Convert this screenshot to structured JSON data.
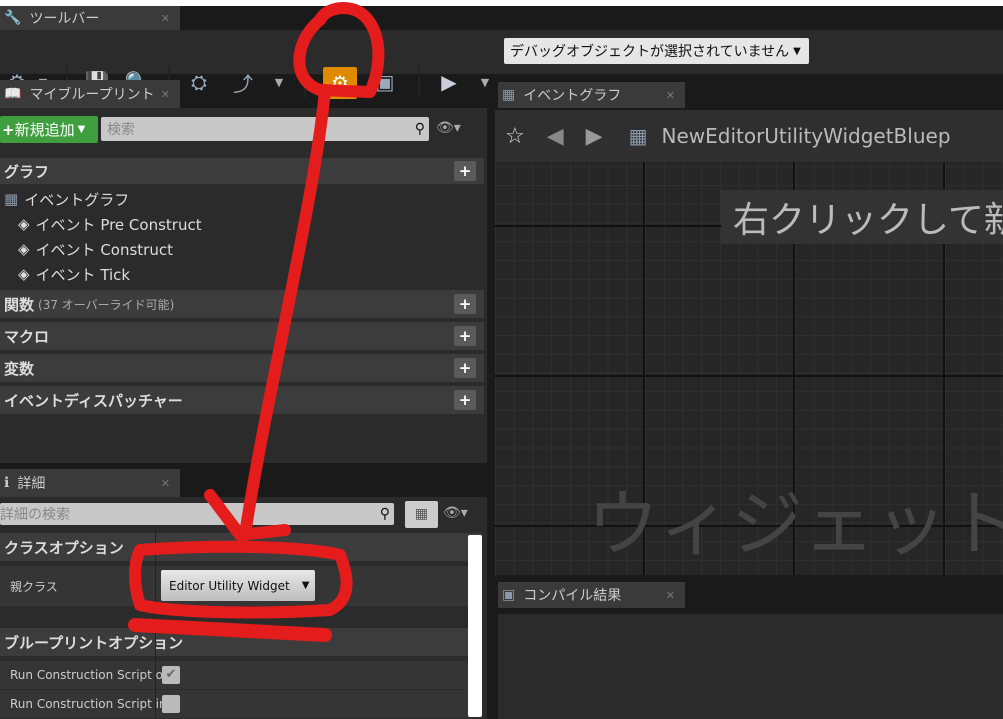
{
  "toolbar_tab": {
    "label": "ツールバー"
  },
  "toolbar": {
    "debug_select": "デバッグオブジェクトが選択されていません"
  },
  "my_blueprint": {
    "tab": "マイブループリント",
    "add_new": "新規追加",
    "search_placeholder": "検索",
    "graph_cat": "グラフ",
    "event_graph": "イベントグラフ",
    "events": [
      "イベント Pre Construct",
      "イベント Construct",
      "イベント Tick"
    ],
    "functions": "関数",
    "functions_note": "(37 オーバーライド可能)",
    "macros": "マクロ",
    "variables": "変数",
    "dispatchers": "イベントディスパッチャー"
  },
  "details": {
    "tab": "詳細",
    "search_placeholder": "詳細の検索",
    "class_options": "クラスオプション",
    "parent_class_label": "親クラス",
    "parent_class_value": "Editor Utility Widget",
    "bp_options": "ブループリントオプション",
    "rows": [
      {
        "label": "Run Construction Script o",
        "checked": true
      },
      {
        "label": "Run Construction Script in",
        "checked": false
      }
    ]
  },
  "graph": {
    "tab": "イベントグラフ",
    "breadcrumb": "NewEditorUtilityWidgetBluep",
    "hint": "右クリックして新",
    "watermark": "ウィジェット"
  },
  "compile": {
    "tab": "コンパイル結果"
  },
  "colors": {
    "annotation": "#e51c1c",
    "active_button": "#e08a00",
    "add_button": "#3f9f3f"
  }
}
